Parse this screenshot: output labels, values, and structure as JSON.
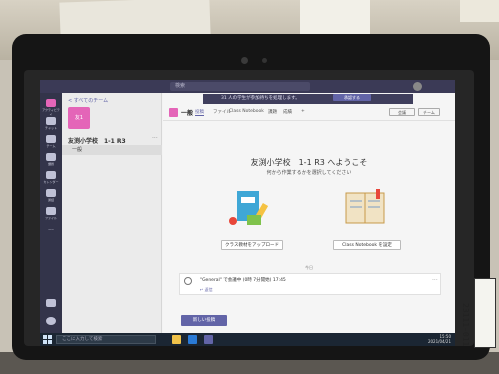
{
  "paper_note": "・・・",
  "teams": {
    "search": {
      "placeholder": "検索"
    },
    "notice": {
      "text": "31 人の学生が参加待ちを処理します。",
      "button": "承認する"
    },
    "sidebar": {
      "back_link": "< すべてのチーム",
      "team_tile": "友1",
      "team_name": "友渕小学校　1-1 R3",
      "team_more": "···",
      "channel_general": "一般"
    },
    "rail": [
      {
        "icon": "activity-icon",
        "label": "アクティビティ"
      },
      {
        "icon": "chat-icon",
        "label": "チャット"
      },
      {
        "icon": "teams-icon",
        "label": "チーム"
      },
      {
        "icon": "assignments-icon",
        "label": "課題"
      },
      {
        "icon": "calendar-icon",
        "label": "カレンダー"
      },
      {
        "icon": "calls-icon",
        "label": "通話"
      },
      {
        "icon": "files-icon",
        "label": "ファイル"
      },
      {
        "icon": "more-icon",
        "label": "···"
      }
    ],
    "header": {
      "title": "一般",
      "tabs": [
        "投稿",
        "ファイル",
        "Class Notebook",
        "課題",
        "成績",
        "+"
      ],
      "meet_button": "会議",
      "team_button": "チーム"
    },
    "welcome": {
      "title": "友渕小学校　1-1 R3 へようこそ",
      "subtitle": "何から作業するかを選択してください"
    },
    "actions": {
      "upload": "クラス教材をアップロード",
      "notebook": "Class Notebook を設定"
    },
    "divider": "今日",
    "post": {
      "text": "\"General\" で会議中 (0時 7分開始) 17:45",
      "reply": "↩ 返信",
      "more": "···"
    },
    "new_conversation": "新しい投稿",
    "taskbar": {
      "search_placeholder": "ここに入力して検索",
      "time": "15:50",
      "date": "2021/04/21"
    }
  },
  "sticker": {
    "text": "23111-011"
  },
  "colors": {
    "accent": "#6264a7",
    "team_tile": "#e465b8",
    "rail": "#33344a",
    "taskbar": "#1b2633"
  }
}
